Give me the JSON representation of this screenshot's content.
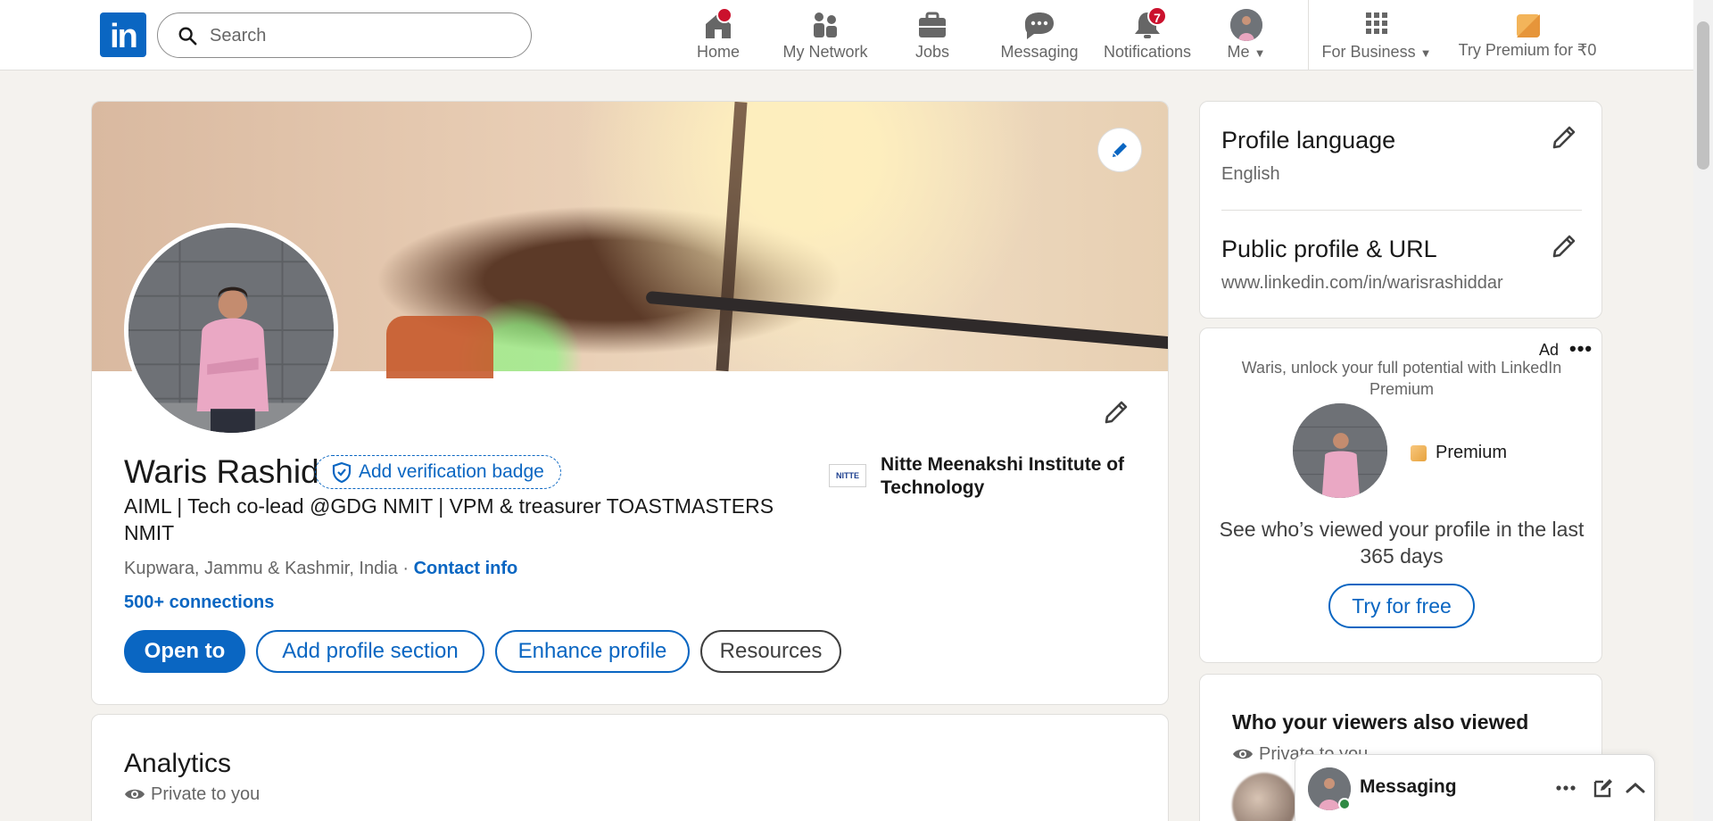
{
  "nav": {
    "logo_text": "in",
    "search_placeholder": "Search",
    "items": [
      {
        "label": "Home",
        "icon": "home-icon",
        "badge": ""
      },
      {
        "label": "My Network",
        "icon": "people-icon",
        "badge": ""
      },
      {
        "label": "Jobs",
        "icon": "briefcase-icon",
        "badge": ""
      },
      {
        "label": "Messaging",
        "icon": "chat-icon",
        "badge": ""
      },
      {
        "label": "Notifications",
        "icon": "bell-icon",
        "badge": "7"
      },
      {
        "label": "Me",
        "icon": "avatar",
        "badge": ""
      },
      {
        "label": "For Business",
        "icon": "grid-icon",
        "badge": ""
      },
      {
        "label": "Try Premium for ₹0",
        "icon": "premium-icon",
        "badge": ""
      }
    ]
  },
  "profile": {
    "name": "Waris Rashid",
    "verify_label": "Add verification badge",
    "headline": "AIML | Tech co-lead @GDG NMIT | VPM & treasurer TOASTMASTERS NMIT",
    "location": "Kupwara, Jammu & Kashmir, India",
    "separator": " · ",
    "contact_label": "Contact info",
    "connections": "500+ connections",
    "education": {
      "logo_text": "NITTE",
      "name": "Nitte Meenakshi Institute of Technology"
    },
    "buttons": {
      "open_to": "Open to",
      "add_section": "Add profile section",
      "enhance": "Enhance profile",
      "resources": "Resources"
    }
  },
  "analytics": {
    "title": "Analytics",
    "privacy": "Private to you"
  },
  "rail": {
    "language_title": "Profile language",
    "language_value": "English",
    "url_title": "Public profile & URL",
    "url_value": "www.linkedin.com/in/warisrashiddar"
  },
  "ad": {
    "label": "Ad",
    "more": "•••",
    "text": "Waris, unlock your full potential with LinkedIn Premium",
    "premium_label": "Premium",
    "body": "See who’s viewed your profile in the last 365 days",
    "cta": "Try for free"
  },
  "viewers": {
    "title": "Who your viewers also viewed",
    "privacy": "Private to you"
  },
  "messaging": {
    "label": "Messaging"
  },
  "colors": {
    "brand": "#0a66c2",
    "badge": "#cb112d",
    "background": "#f4f2ee"
  }
}
